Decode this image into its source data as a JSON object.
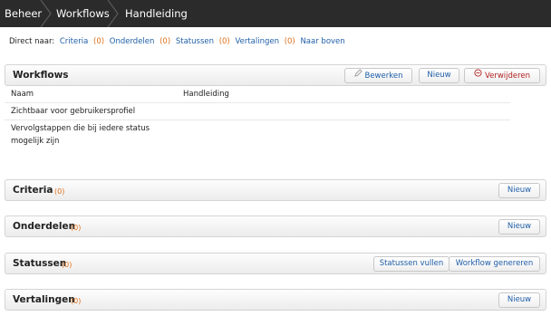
{
  "breadcrumb": [
    "Beheer",
    "Workflows",
    "Handleiding"
  ],
  "direct_naar": {
    "label": "Direct naar:",
    "links": [
      {
        "label": "Criteria",
        "count": "(0)"
      },
      {
        "label": "Onderdelen",
        "count": "(0)"
      },
      {
        "label": "Statussen",
        "count": "(0)"
      },
      {
        "label": "Vertalingen",
        "count": "(0)"
      },
      {
        "label": "Naar boven",
        "count": ""
      }
    ]
  },
  "workflows": {
    "title": "Workflows",
    "buttons": {
      "edit": "Bewerken",
      "new": "Nieuw",
      "delete": "Verwijderen"
    },
    "rows": [
      {
        "key": "Naam",
        "value": "Handleiding"
      },
      {
        "key": "Zichtbaar voor gebruikersprofiel",
        "value": ""
      },
      {
        "key": "Vervolgstappen die bij iedere status mogelijk zijn",
        "value": ""
      }
    ]
  },
  "criteria": {
    "title": "Criteria",
    "count": "(0)",
    "new": "Nieuw"
  },
  "onderdelen": {
    "title": "Onderdelen",
    "count": "(0)",
    "new": "Nieuw"
  },
  "statussen": {
    "title": "Statussen",
    "count": "(0)",
    "fill": "Statussen vullen",
    "generate": "Workflow genereren"
  },
  "vertalingen": {
    "title": "Vertalingen",
    "count": "(0)",
    "new": "Nieuw"
  },
  "colors": {
    "topbar": "#2b2b2b",
    "link": "#1f5fa8",
    "count": "#e0701a",
    "delete": "#b22222"
  },
  "icons": {
    "edit": "pencil-icon",
    "delete": "minus-circle-icon"
  }
}
